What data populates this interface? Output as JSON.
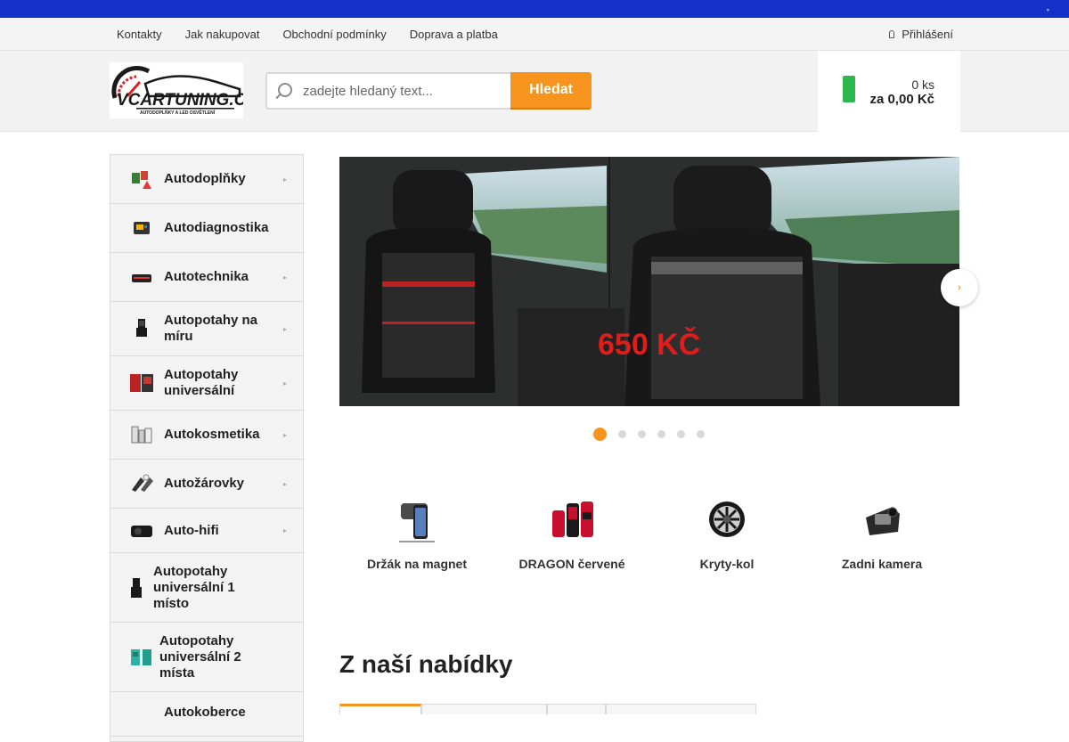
{
  "topnav": {
    "links": [
      "Kontakty",
      "Jak nakupovat",
      "Obchodní podmínky",
      "Doprava a platba"
    ],
    "login": "Přihlášení"
  },
  "logo": {
    "text": "VCARTUNING.CZ",
    "tagline": "AUTODOPLŇKY A LED OSVĚTLENÍ"
  },
  "search": {
    "placeholder": "zadejte hledaný text...",
    "button": "Hledat"
  },
  "cart": {
    "count": "0 ks",
    "total": "za 0,00 Kč"
  },
  "sidebar": {
    "categories": [
      {
        "label": "Autodoplňky",
        "has_submenu": true
      },
      {
        "label": "Autodiagnostika",
        "has_submenu": false
      },
      {
        "label": "Autotechnika",
        "has_submenu": true
      },
      {
        "label": "Autopotahy na míru",
        "has_submenu": true
      },
      {
        "label": "Autopotahy universální",
        "has_submenu": true
      },
      {
        "label": "Autokosmetika",
        "has_submenu": true
      },
      {
        "label": "Autožárovky",
        "has_submenu": true
      },
      {
        "label": "Auto-hifi",
        "has_submenu": true
      },
      {
        "label": "Autopotahy universální 1 místo",
        "has_submenu": false
      },
      {
        "label": "Autopotahy universální 2 místa",
        "has_submenu": false
      },
      {
        "label": "Autokoberce",
        "has_submenu": false
      }
    ]
  },
  "slider": {
    "price": "650 KČ",
    "slides": 6,
    "active_slide": 1
  },
  "features": [
    {
      "label": "Držák na magnet",
      "icon": "phone-holder-icon"
    },
    {
      "label": "DRAGON červené",
      "icon": "seat-covers-icon"
    },
    {
      "label": "Kryty-kol",
      "icon": "wheel-cover-icon"
    },
    {
      "label": "Zadni kamera",
      "icon": "camera-icon"
    }
  ],
  "section": {
    "title": "Z naší nabídky"
  },
  "colors": {
    "brand_blue": "#1432c8",
    "accent_orange": "#f7941d",
    "cart_green": "#2db84d"
  }
}
